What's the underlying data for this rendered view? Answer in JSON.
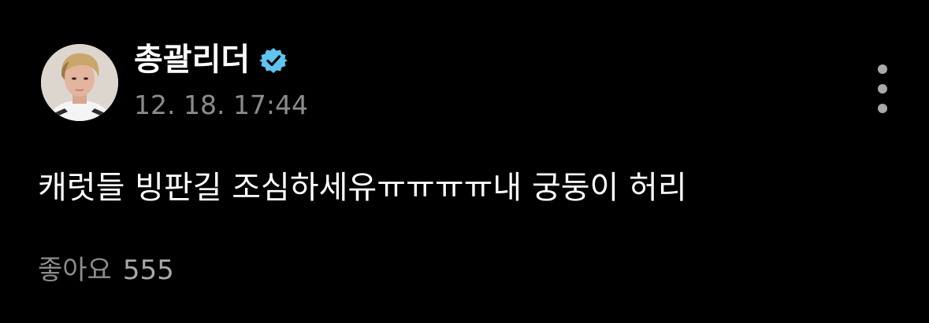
{
  "post": {
    "author": {
      "name": "총괄리더",
      "verified": true,
      "verified_icon": "verified-badge-icon",
      "avatar_icon": "profile-avatar"
    },
    "timestamp": "12. 18. 17:44",
    "body": "캐럿들 빙판길 조심하세유ㅠㅠㅠㅠ내 궁둥이 허리",
    "likes": {
      "label": "좋아요",
      "count": "555"
    },
    "more_icon": "more-vertical-icon"
  },
  "colors": {
    "background": "#000000",
    "text_primary": "#ffffff",
    "text_secondary": "#8c8c8c",
    "verified_badge": "#5fc4ee",
    "more_dots": "#a9a9a9"
  }
}
